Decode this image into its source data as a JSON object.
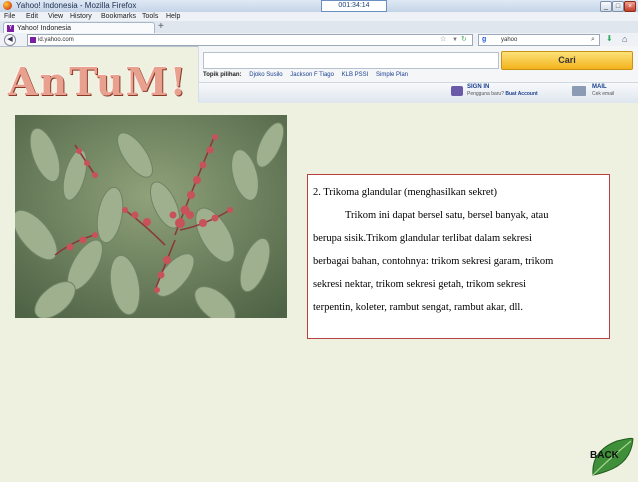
{
  "browser": {
    "window_title": "Yahoo! Indonesia - Mozilla Firefox",
    "timer": "001:34:14",
    "window_buttons": {
      "minimize": "_",
      "maximize": "□",
      "close": "×"
    },
    "menu": [
      "File",
      "Edit",
      "View",
      "History",
      "Bookmarks",
      "Tools",
      "Help"
    ],
    "tab_label": "Yahoo! Indonesia",
    "new_tab_label": "+",
    "url": "id.yahoo.com",
    "search_engine_label": "g",
    "search_text": "yahoo"
  },
  "logo": {
    "text": "AnTuM!"
  },
  "yahoo": {
    "search_button": "Cari",
    "topics_label": "Topik pilihan:",
    "topics": [
      "Djoko Susilo",
      "Jackson F Tiago",
      "KLB PSSI",
      "Simple Plan"
    ],
    "signin_label": "SIGN IN",
    "new_user_prefix": "Pengguna baru?",
    "new_user_link": "Buat Account",
    "mail_label": "MAIL",
    "mail_sub": "Cek email"
  },
  "content": {
    "heading": "2. Trikoma glandular (menghasilkan sekret)",
    "paragraph_lines": [
      "Trikom ini dapat bersel satu, bersel banyak, atau",
      "berupa sisik.Trikom glandular terlibat dalam sekresi",
      "berbagai bahan, contohnya: trikom sekresi garam, trikom",
      "sekresi nektar, trikom sekresi getah, trikom sekresi",
      "terpentin, koleter, rambut sengat, rambut akar, dll."
    ]
  },
  "nav": {
    "back_label": "BACK"
  },
  "colors": {
    "background": "#eef0e0",
    "logo": "#e8a08f",
    "textbox_border": "#b94040",
    "leaf": "#3f8f3a"
  }
}
